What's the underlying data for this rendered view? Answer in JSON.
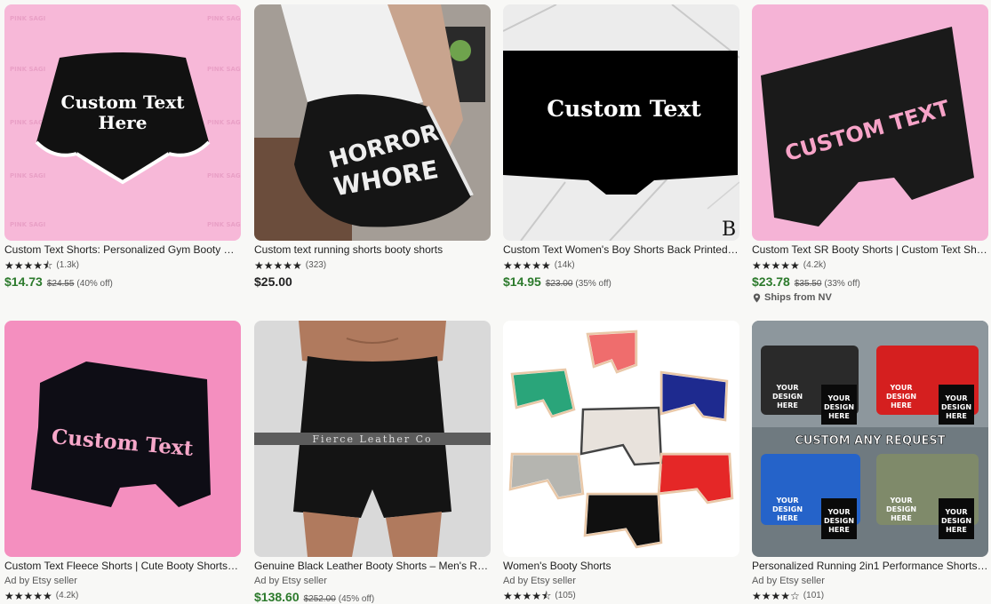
{
  "listings": [
    {
      "title": "Custom Text Shorts: Personalized Gym Booty Shorts",
      "image_text": [
        "Custom Text",
        "Here"
      ],
      "watermark": "PINK SAGI",
      "stars": "★★★★⯪",
      "reviews": "(1.3k)",
      "price": "$14.73",
      "original_price": "$24.55",
      "discount": "(40% off)"
    },
    {
      "title": "Custom text running shorts booty shorts",
      "image_text": [
        "HORROR",
        "WHORE"
      ],
      "stars": "★★★★★",
      "reviews": "(323)",
      "price": "$25.00"
    },
    {
      "title": "Custom Text Women's Boy Shorts Back Printed S-2...",
      "image_text": [
        "Custom Text"
      ],
      "logo": "B",
      "stars": "★★★★★",
      "reviews": "(14k)",
      "price": "$14.95",
      "original_price": "$23.00",
      "discount": "(35% off)"
    },
    {
      "title": "Custom Text SR Booty Shorts | Custom Text Shorts...",
      "image_text": [
        "CUSTOM TEXT"
      ],
      "stars": "★★★★★",
      "reviews": "(4.2k)",
      "price": "$23.78",
      "original_price": "$35.50",
      "discount": "(33% off)",
      "ships": "Ships from NV"
    },
    {
      "title": "Custom Text Fleece Shorts | Cute Booty Shorts | Y...",
      "ad": "Ad by Etsy seller",
      "image_text": [
        "Custom Text"
      ],
      "stars": "★★★★★",
      "reviews": "(4.2k)"
    },
    {
      "title": "Genuine Black Leather Booty Shorts – Men's Rave ...",
      "ad": "Ad by Etsy seller",
      "image_text": [
        "Fierce Leather Co"
      ],
      "price": "$138.60",
      "original_price": "$252.00",
      "discount": "(45% off)"
    },
    {
      "title": "Women's Booty Shorts",
      "ad": "Ad by Etsy seller",
      "stars": "★★★★⯪",
      "reviews": "(105)"
    },
    {
      "title": "Personalized Running 2in1 Performance Shorts Gy...",
      "ad": "Ad by Etsy seller",
      "image_text": [
        "YOUR",
        "DESIGN",
        "HERE",
        "CUSTOM ANY REQUEST"
      ],
      "stars": "★★★★☆",
      "reviews": "(101)"
    }
  ]
}
